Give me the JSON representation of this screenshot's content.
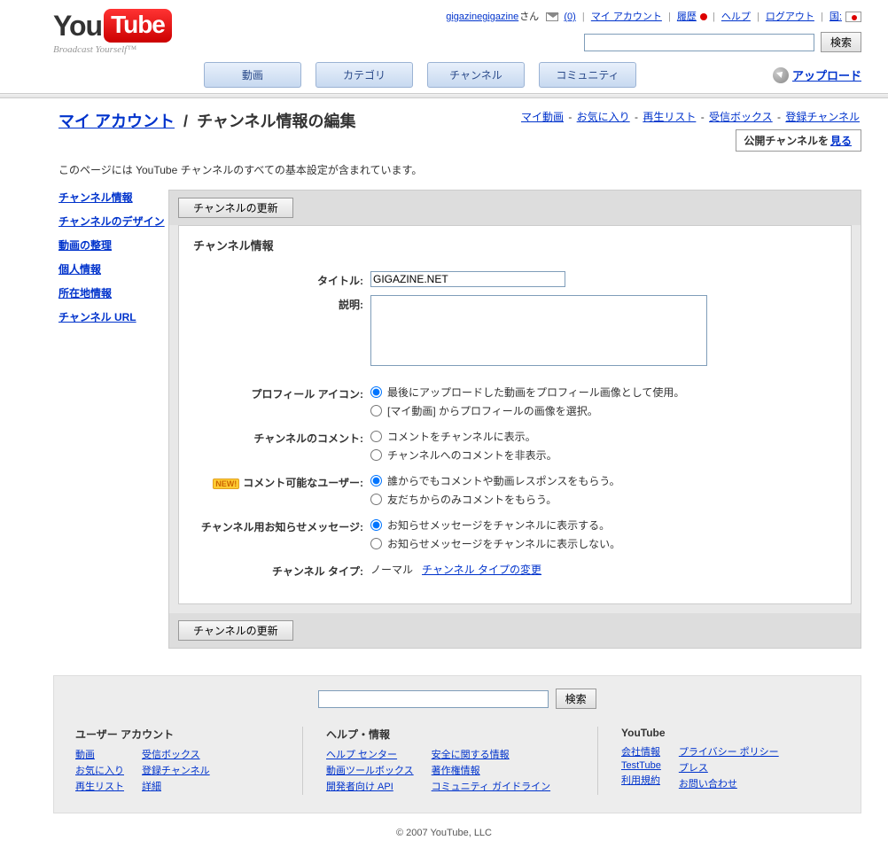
{
  "logo": {
    "left": "You",
    "right": "Tube",
    "tagline": "Broadcast Yourself™"
  },
  "userbar": {
    "username": "gigazinegigazine",
    "san": "さん",
    "inbox_count": "(0)",
    "my_account": "マイ アカウント",
    "history": "履歴",
    "help": "ヘルプ",
    "logout": "ログアウト",
    "country": "国:"
  },
  "search": {
    "button": "検索"
  },
  "nav": {
    "videos": "動画",
    "categories": "カテゴリ",
    "channels": "チャンネル",
    "community": "コミュニティ",
    "upload": "アップロード"
  },
  "title": {
    "my_account": "マイ アカウント",
    "separator": "/",
    "page": "チャンネル情報の編集",
    "links": {
      "my_videos": "マイ動画",
      "favorites": "お気に入り",
      "playlists": "再生リスト",
      "inbox": "受信ボックス",
      "subscriptions": "登録チャンネル"
    },
    "view_prefix": "公開チャンネルを",
    "view_link": "見る",
    "description": "このページには YouTube チャンネルのすべての基本設定が含まれています。"
  },
  "sidebar": {
    "channel_info": "チャンネル情報",
    "channel_design": "チャンネルのデザイン",
    "organize_videos": "動画の整理",
    "personal_info": "個人情報",
    "location_info": "所在地情報",
    "channel_url": "チャンネル URL"
  },
  "form": {
    "update_btn": "チャンネルの更新",
    "panel_title": "チャンネル情報",
    "title_label": "タイトル:",
    "title_value": "GIGAZINE.NET",
    "desc_label": "説明:",
    "icon_label": "プロフィール アイコン:",
    "icon_opt1": "最後にアップロードした動画をプロフィール画像として使用。",
    "icon_opt2": "[マイ動画] からプロフィールの画像を選択。",
    "comment_label": "チャンネルのコメント:",
    "comment_opt1": "コメントをチャンネルに表示。",
    "comment_opt2": "チャンネルへのコメントを非表示。",
    "who_label": "コメント可能なユーザー:",
    "new_badge": "NEW!",
    "who_opt1": "誰からでもコメントや動画レスポンスをもらう。",
    "who_opt2": "友だちからのみコメントをもらう。",
    "bulletin_label": "チャンネル用お知らせメッセージ:",
    "bulletin_opt1": "お知らせメッセージをチャンネルに表示する。",
    "bulletin_opt2": "お知らせメッセージをチャンネルに表示しない。",
    "type_label": "チャンネル タイプ:",
    "type_value": "ノーマル",
    "type_link": "チャンネル タイプの変更"
  },
  "footer": {
    "user_account": "ユーザー アカウント",
    "ua_videos": "動画",
    "ua_favorites": "お気に入り",
    "ua_playlists": "再生リスト",
    "ua_inbox": "受信ボックス",
    "ua_subscriptions": "登録チャンネル",
    "ua_more": "詳細",
    "help_info": "ヘルプ・情報",
    "hi_help_center": "ヘルプ センター",
    "hi_toolbox": "動画ツールボックス",
    "hi_dev_api": "開発者向け API",
    "hi_safety": "安全に関する情報",
    "hi_copyright": "著作権情報",
    "hi_guidelines": "コミュニティ ガイドライン",
    "yt": "YouTube",
    "yt_company": "会社情報",
    "yt_testtube": "TestTube",
    "yt_terms": "利用規約",
    "yt_privacy": "プライバシー ポリシー",
    "yt_press": "プレス",
    "yt_contact": "お問い合わせ",
    "copyright": "© 2007 YouTube, LLC"
  }
}
